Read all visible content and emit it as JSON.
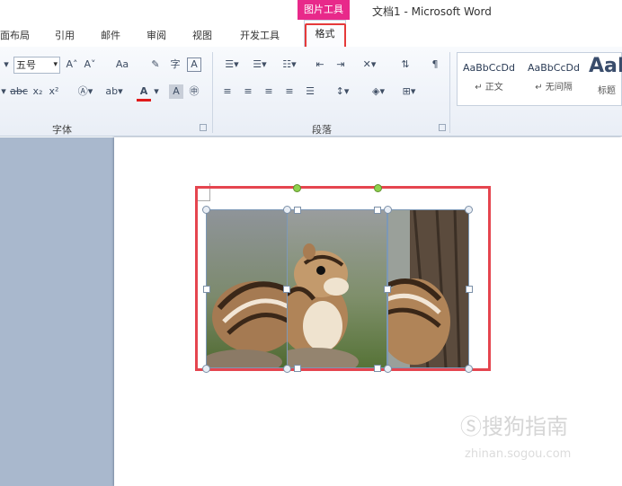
{
  "title_bar": {
    "context_tab_group": "图片工具",
    "document_title": "文档1 - Microsoft Word"
  },
  "tabs": [
    {
      "label": "面布局"
    },
    {
      "label": "引用"
    },
    {
      "label": "邮件"
    },
    {
      "label": "审阅"
    },
    {
      "label": "视图"
    },
    {
      "label": "开发工具"
    }
  ],
  "active_tab": {
    "label": "格式"
  },
  "ribbon": {
    "font_group": {
      "label": "字体",
      "font_size": "五号",
      "grow_font": "A˄",
      "shrink_font": "A˅",
      "change_case": "Aa",
      "strikethrough": "abc",
      "subscript": "x₂",
      "superscript": "x²",
      "font_color_letter": "A"
    },
    "paragraph_group": {
      "label": "段落"
    },
    "styles_group": {
      "items": [
        {
          "sample": "AaBbCcDd",
          "name": "↵ 正文"
        },
        {
          "sample": "AaBbCcDd",
          "name": "↵ 无间隔"
        },
        {
          "sample": "AaI",
          "name": "标题"
        }
      ]
    }
  },
  "watermark": {
    "main": "搜狗指南",
    "sub": "zhinan.sogou.com"
  },
  "colors": {
    "context_tab": "#e8298a",
    "highlight": "#e53a3a",
    "ribbon_bg": "#eef2f8",
    "doc_bg": "#a9b8cd"
  }
}
